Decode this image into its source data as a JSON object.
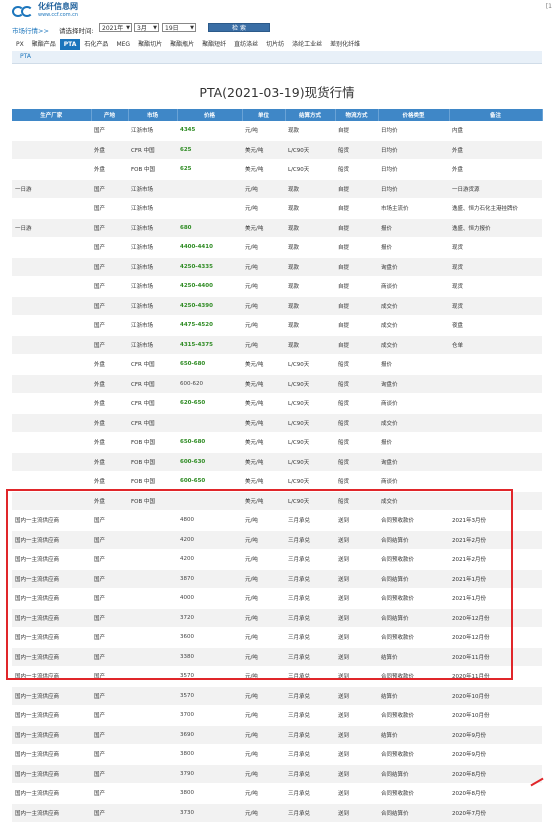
{
  "header": {
    "logo_title": "化纤信息网",
    "logo_url": "www.ccf.com.cn",
    "corner": "[1"
  },
  "filter": {
    "breadcrumb": "市场行情>>",
    "select_label": "请选择时间:",
    "year": "2021年",
    "month": "3月",
    "day": "19日",
    "search_label": "检 索"
  },
  "tabs": [
    "PX",
    "聚酯产品",
    "PTA",
    "石化产品",
    "MEG",
    "聚酯切片",
    "聚酯瓶片",
    "聚酯短纤",
    "直纺涤丝",
    "切片纺",
    "涤纶工业丝",
    "差别化纤维"
  ],
  "active_tab": 2,
  "subbar": "PTA",
  "page_title": "PTA(2021-03-19)现货行情",
  "columns": [
    "生产厂家",
    "产地",
    "市场",
    "价格",
    "单位",
    "结算方式",
    "物流方式",
    "价格类型",
    "备注"
  ],
  "rows": [
    [
      "",
      "国产",
      "江浙市场",
      "4345",
      "元/吨",
      "现款",
      "自提",
      "日均价",
      "内盘"
    ],
    [
      "",
      "外盘",
      "CFR 中国",
      "625",
      "美元/吨",
      "L/C90天",
      "船货",
      "日均价",
      "外盘"
    ],
    [
      "",
      "外盘",
      "FOB 中国",
      "625",
      "美元/吨",
      "L/C90天",
      "船货",
      "日均价",
      "外盘"
    ],
    [
      "一日游",
      "国产",
      "江浙市场",
      "",
      "元/吨",
      "现款",
      "自提",
      "日均价",
      "一日游货源"
    ],
    [
      "",
      "国产",
      "江浙市场",
      "",
      "元/吨",
      "现款",
      "自提",
      "市场主流价",
      "逸盛、恒力石化主港挂牌价"
    ],
    [
      "一日游",
      "国产",
      "江浙市场",
      "680",
      "美元/吨",
      "现款",
      "自提",
      "报价",
      "逸盛、恒力报价"
    ],
    [
      "",
      "国产",
      "江浙市场",
      "4400-4410",
      "元/吨",
      "现款",
      "自提",
      "报价",
      "现货"
    ],
    [
      "",
      "国产",
      "江浙市场",
      "4250-4335",
      "元/吨",
      "现款",
      "自提",
      "询盘价",
      "现货"
    ],
    [
      "",
      "国产",
      "江浙市场",
      "4250-4400",
      "元/吨",
      "现款",
      "自提",
      "商谈价",
      "现货"
    ],
    [
      "",
      "国产",
      "江浙市场",
      "4250-4390",
      "元/吨",
      "现款",
      "自提",
      "成交价",
      "现货"
    ],
    [
      "",
      "国产",
      "江浙市场",
      "4475-4520",
      "元/吨",
      "现款",
      "自提",
      "成交价",
      "夜盘"
    ],
    [
      "",
      "国产",
      "江浙市场",
      "4315-4375",
      "元/吨",
      "现款",
      "自提",
      "成交价",
      "仓单"
    ],
    [
      "",
      "外盘",
      "CFR 中国",
      "650-680",
      "美元/吨",
      "L/C90天",
      "船货",
      "报价",
      ""
    ],
    [
      "",
      "外盘",
      "CFR 中国",
      "600-620",
      "美元/吨",
      "L/C90天",
      "船货",
      "询盘价",
      ""
    ],
    [
      "",
      "外盘",
      "CFR 中国",
      "620-650",
      "美元/吨",
      "L/C90天",
      "船货",
      "商谈价",
      ""
    ],
    [
      "",
      "外盘",
      "CFR 中国",
      "",
      "美元/吨",
      "L/C90天",
      "船货",
      "成交价",
      ""
    ],
    [
      "",
      "外盘",
      "FOB 中国",
      "650-680",
      "美元/吨",
      "L/C90天",
      "船货",
      "报价",
      ""
    ],
    [
      "",
      "外盘",
      "FOB 中国",
      "600-630",
      "美元/吨",
      "L/C90天",
      "船货",
      "询盘价",
      ""
    ],
    [
      "",
      "外盘",
      "FOB 中国",
      "600-650",
      "美元/吨",
      "L/C90天",
      "船货",
      "商谈价",
      ""
    ],
    [
      "",
      "外盘",
      "FOB 中国",
      "",
      "美元/吨",
      "L/C90天",
      "船货",
      "成交价",
      ""
    ],
    [
      "国内一主流供应商",
      "国产",
      "",
      "4800",
      "元/吨",
      "三月承兑",
      "送到",
      "合同预收款价",
      "2021年3月份"
    ],
    [
      "国内一主流供应商",
      "国产",
      "",
      "4200",
      "元/吨",
      "三月承兑",
      "送到",
      "合同结算价",
      "2021年2月份"
    ],
    [
      "国内一主流供应商",
      "国产",
      "",
      "4200",
      "元/吨",
      "三月承兑",
      "送到",
      "合同预收款价",
      "2021年2月份"
    ],
    [
      "国内一主流供应商",
      "国产",
      "",
      "3870",
      "元/吨",
      "三月承兑",
      "送到",
      "合同结算价",
      "2021年1月份"
    ],
    [
      "国内一主流供应商",
      "国产",
      "",
      "4000",
      "元/吨",
      "三月承兑",
      "送到",
      "合同预收款价",
      "2021年1月份"
    ],
    [
      "国内一主流供应商",
      "国产",
      "",
      "3720",
      "元/吨",
      "三月承兑",
      "送到",
      "合同结算价",
      "2020年12月份"
    ],
    [
      "国内一主流供应商",
      "国产",
      "",
      "3600",
      "元/吨",
      "三月承兑",
      "送到",
      "合同预收款价",
      "2020年12月份"
    ],
    [
      "国内一主流供应商",
      "国产",
      "",
      "3380",
      "元/吨",
      "三月承兑",
      "送到",
      "结算价",
      "2020年11月份"
    ],
    [
      "国内一主流供应商",
      "国产",
      "",
      "3570",
      "元/吨",
      "三月承兑",
      "送到",
      "合同预收款价",
      "2020年11月份"
    ],
    [
      "国内一主流供应商",
      "国产",
      "",
      "3570",
      "元/吨",
      "三月承兑",
      "送到",
      "结算价",
      "2020年10月份"
    ],
    [
      "国内一主流供应商",
      "国产",
      "",
      "3700",
      "元/吨",
      "三月承兑",
      "送到",
      "合同预收款价",
      "2020年10月份"
    ],
    [
      "国内一主流供应商",
      "国产",
      "",
      "3690",
      "元/吨",
      "三月承兑",
      "送到",
      "结算价",
      "2020年9月份"
    ],
    [
      "国内一主流供应商",
      "国产",
      "",
      "3800",
      "元/吨",
      "三月承兑",
      "送到",
      "合同预收款价",
      "2020年9月份"
    ],
    [
      "国内一主流供应商",
      "国产",
      "",
      "3790",
      "元/吨",
      "三月承兑",
      "送到",
      "合同结算价",
      "2020年8月份"
    ],
    [
      "国内一主流供应商",
      "国产",
      "",
      "3800",
      "元/吨",
      "三月承兑",
      "送到",
      "合同预收款价",
      "2020年8月份"
    ],
    [
      "国内一主流供应商",
      "国产",
      "",
      "3730",
      "元/吨",
      "三月承兑",
      "送到",
      "合同结算价",
      "2020年7月份"
    ]
  ],
  "green_price_rows": [
    0,
    1,
    2,
    5,
    6,
    7,
    8,
    9,
    10,
    11,
    12,
    14,
    16,
    17,
    18
  ],
  "colors": {
    "brand": "#1b75bc",
    "header_bg": "#3f87c7",
    "price_green": "#2e8b23",
    "highlight": "#e0262a"
  }
}
